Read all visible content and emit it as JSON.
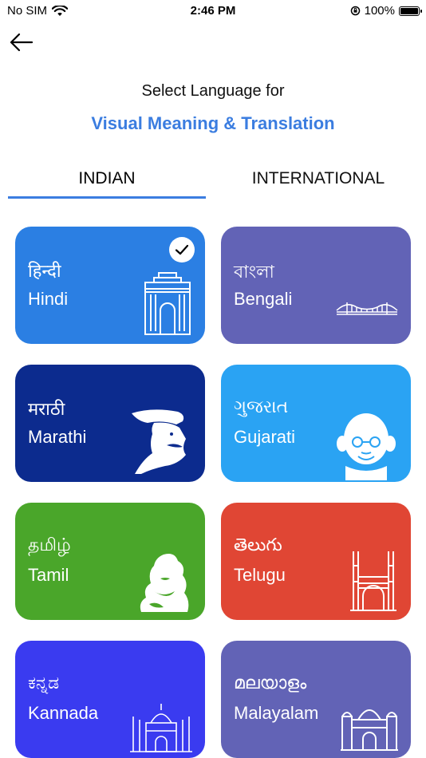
{
  "status": {
    "carrier": "No SIM",
    "time": "2:46 PM",
    "battery": "100%"
  },
  "header": {
    "title": "Select Language for",
    "subtitle": "Visual Meaning & Translation"
  },
  "tabs": [
    {
      "label": "INDIAN",
      "active": true
    },
    {
      "label": "INTERNATIONAL",
      "active": false
    }
  ],
  "languages": [
    {
      "native": "हिन्दी",
      "english": "Hindi",
      "color": "#2b7fe3",
      "selected": true,
      "icon": "india-gate-icon"
    },
    {
      "native": "বাংলা",
      "english": "Bengali",
      "color": "#6263b6",
      "selected": false,
      "icon": "howrah-bridge-icon"
    },
    {
      "native": "मराठी",
      "english": "Marathi",
      "color": "#0c2b8e",
      "selected": false,
      "icon": "shivaji-portrait-icon"
    },
    {
      "native": "ગુજરાત",
      "english": "Gujarati",
      "color": "#2aa3f3",
      "selected": false,
      "icon": "gandhi-portrait-icon"
    },
    {
      "native": "தமிழ்",
      "english": "Tamil",
      "color": "#4aa62a",
      "selected": false,
      "icon": "adiyogi-statue-icon"
    },
    {
      "native": "తెలుగు",
      "english": "Telugu",
      "color": "#e04634",
      "selected": false,
      "icon": "charminar-icon"
    },
    {
      "native": "ಕನ್ನಡ",
      "english": "Kannada",
      "color": "#3a3bf0",
      "selected": false,
      "icon": "mysore-palace-icon"
    },
    {
      "native": "മലയാളം",
      "english": "Malayalam",
      "color": "#6263b6",
      "selected": false,
      "icon": "mosque-icon"
    }
  ]
}
